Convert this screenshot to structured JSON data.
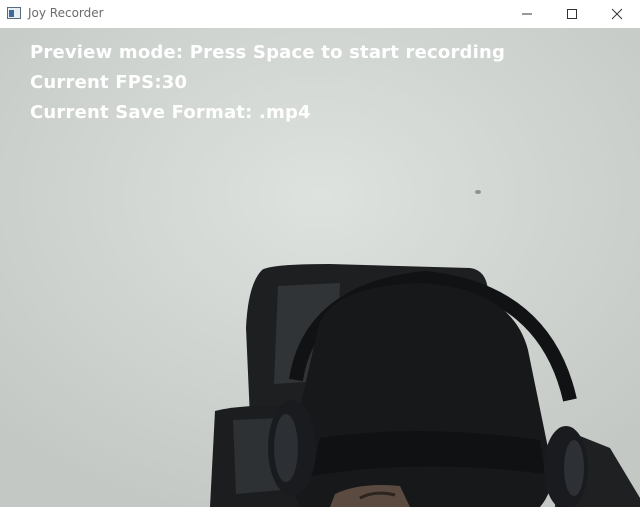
{
  "window": {
    "title": "Joy Recorder",
    "icon": "app-window-icon",
    "controls": {
      "minimize": "minimize-icon",
      "maximize": "maximize-icon",
      "close": "close-icon"
    }
  },
  "overlay": {
    "status_line": "Preview mode: Press Space to start recording",
    "fps_line": "Current FPS:30",
    "format_line": "Current Save Format: .mp4"
  }
}
